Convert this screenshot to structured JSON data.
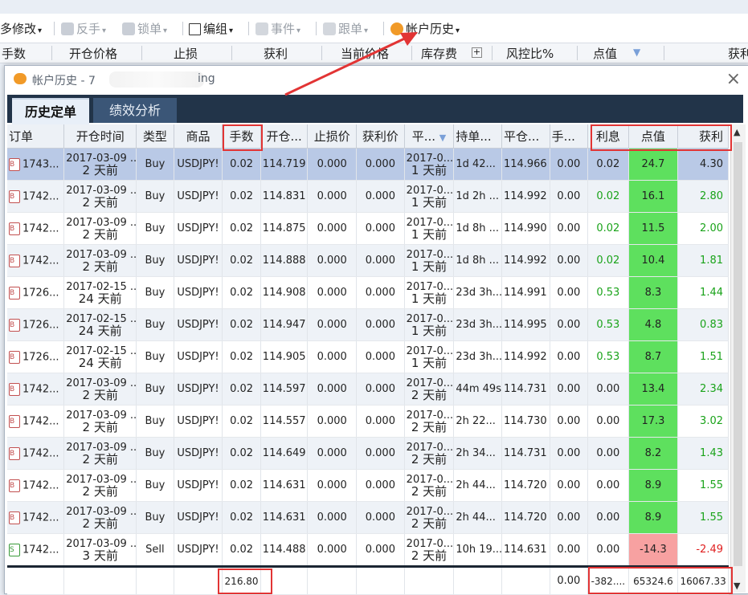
{
  "toolbar": {
    "items": [
      {
        "label": "多修改",
        "disabled": false
      },
      {
        "label": "反手",
        "disabled": true
      },
      {
        "label": "锁单",
        "disabled": true
      },
      {
        "label": "编组",
        "disabled": false
      },
      {
        "label": "事件",
        "disabled": true
      },
      {
        "label": "跟单",
        "disabled": true
      },
      {
        "label": "帐户历史",
        "disabled": false
      }
    ]
  },
  "bg_header": [
    "手数",
    "开仓价格",
    "止损",
    "获利",
    "当前价格",
    "库存费",
    "风控比%",
    "点值",
    "获利"
  ],
  "dialog": {
    "title": "帐户历史 - 7",
    "title_tail": "ing",
    "close": "×",
    "tabs": [
      "历史定单",
      "绩效分析"
    ]
  },
  "columns": [
    "订单",
    "开仓时间",
    "类型",
    "商品",
    "手数",
    "开仓...",
    "止损价",
    "获利价",
    "平...",
    "持单...",
    "平仓...",
    "手...",
    "利息",
    "点值",
    "获利"
  ],
  "rows": [
    {
      "order": "1743...",
      "type_icon": "B",
      "open_time": "2017-03-09 ...",
      "open_ago": "2 天前",
      "type": "Buy",
      "symbol": "USDJPY!",
      "lots": "0.02",
      "open_price": "114.719",
      "sl": "0.000",
      "tp": "0.000",
      "close_time": "2017-0...",
      "close_ago": "1 天前",
      "hold": "1d 42...",
      "close_price": "114.966",
      "fee": "0.00",
      "swap": "0.02",
      "points": "24.7",
      "profit": "4.30"
    },
    {
      "order": "1742...",
      "type_icon": "B",
      "open_time": "2017-03-09 ...",
      "open_ago": "2 天前",
      "type": "Buy",
      "symbol": "USDJPY!",
      "lots": "0.02",
      "open_price": "114.831",
      "sl": "0.000",
      "tp": "0.000",
      "close_time": "2017-0...",
      "close_ago": "1 天前",
      "hold": "1d 2h ...",
      "close_price": "114.992",
      "fee": "0.00",
      "swap": "0.02",
      "points": "16.1",
      "profit": "2.80"
    },
    {
      "order": "1742...",
      "type_icon": "B",
      "open_time": "2017-03-09 ...",
      "open_ago": "2 天前",
      "type": "Buy",
      "symbol": "USDJPY!",
      "lots": "0.02",
      "open_price": "114.875",
      "sl": "0.000",
      "tp": "0.000",
      "close_time": "2017-0...",
      "close_ago": "1 天前",
      "hold": "1d 8h ...",
      "close_price": "114.990",
      "fee": "0.00",
      "swap": "0.02",
      "points": "11.5",
      "profit": "2.00"
    },
    {
      "order": "1742...",
      "type_icon": "B",
      "open_time": "2017-03-09 ...",
      "open_ago": "2 天前",
      "type": "Buy",
      "symbol": "USDJPY!",
      "lots": "0.02",
      "open_price": "114.888",
      "sl": "0.000",
      "tp": "0.000",
      "close_time": "2017-0...",
      "close_ago": "1 天前",
      "hold": "1d 8h ...",
      "close_price": "114.992",
      "fee": "0.00",
      "swap": "0.02",
      "points": "10.4",
      "profit": "1.81"
    },
    {
      "order": "1726...",
      "type_icon": "B",
      "open_time": "2017-02-15 ...",
      "open_ago": "24 天前",
      "type": "Buy",
      "symbol": "USDJPY!",
      "lots": "0.02",
      "open_price": "114.908",
      "sl": "0.000",
      "tp": "0.000",
      "close_time": "2017-0...",
      "close_ago": "1 天前",
      "hold": "23d 3h...",
      "close_price": "114.991",
      "fee": "0.00",
      "swap": "0.53",
      "points": "8.3",
      "profit": "1.44"
    },
    {
      "order": "1726...",
      "type_icon": "B",
      "open_time": "2017-02-15 ...",
      "open_ago": "24 天前",
      "type": "Buy",
      "symbol": "USDJPY!",
      "lots": "0.02",
      "open_price": "114.947",
      "sl": "0.000",
      "tp": "0.000",
      "close_time": "2017-0...",
      "close_ago": "1 天前",
      "hold": "23d 3h...",
      "close_price": "114.995",
      "fee": "0.00",
      "swap": "0.53",
      "points": "4.8",
      "profit": "0.83"
    },
    {
      "order": "1726...",
      "type_icon": "B",
      "open_time": "2017-02-15 ...",
      "open_ago": "24 天前",
      "type": "Buy",
      "symbol": "USDJPY!",
      "lots": "0.02",
      "open_price": "114.905",
      "sl": "0.000",
      "tp": "0.000",
      "close_time": "2017-0...",
      "close_ago": "1 天前",
      "hold": "23d 3h...",
      "close_price": "114.992",
      "fee": "0.00",
      "swap": "0.53",
      "points": "8.7",
      "profit": "1.51"
    },
    {
      "order": "1742...",
      "type_icon": "B",
      "open_time": "2017-03-09 ...",
      "open_ago": "2 天前",
      "type": "Buy",
      "symbol": "USDJPY!",
      "lots": "0.02",
      "open_price": "114.597",
      "sl": "0.000",
      "tp": "0.000",
      "close_time": "2017-0...",
      "close_ago": "2 天前",
      "hold": "44m 49s",
      "close_price": "114.731",
      "fee": "0.00",
      "swap": "0.00",
      "points": "13.4",
      "profit": "2.34"
    },
    {
      "order": "1742...",
      "type_icon": "B",
      "open_time": "2017-03-09 ...",
      "open_ago": "2 天前",
      "type": "Buy",
      "symbol": "USDJPY!",
      "lots": "0.02",
      "open_price": "114.557",
      "sl": "0.000",
      "tp": "0.000",
      "close_time": "2017-0...",
      "close_ago": "2 天前",
      "hold": "2h 22...",
      "close_price": "114.730",
      "fee": "0.00",
      "swap": "0.00",
      "points": "17.3",
      "profit": "3.02"
    },
    {
      "order": "1742...",
      "type_icon": "B",
      "open_time": "2017-03-09 ...",
      "open_ago": "2 天前",
      "type": "Buy",
      "symbol": "USDJPY!",
      "lots": "0.02",
      "open_price": "114.649",
      "sl": "0.000",
      "tp": "0.000",
      "close_time": "2017-0...",
      "close_ago": "2 天前",
      "hold": "2h 34...",
      "close_price": "114.731",
      "fee": "0.00",
      "swap": "0.00",
      "points": "8.2",
      "profit": "1.43"
    },
    {
      "order": "1742...",
      "type_icon": "B",
      "open_time": "2017-03-09 ...",
      "open_ago": "2 天前",
      "type": "Buy",
      "symbol": "USDJPY!",
      "lots": "0.02",
      "open_price": "114.631",
      "sl": "0.000",
      "tp": "0.000",
      "close_time": "2017-0...",
      "close_ago": "2 天前",
      "hold": "2h 44...",
      "close_price": "114.720",
      "fee": "0.00",
      "swap": "0.00",
      "points": "8.9",
      "profit": "1.55"
    },
    {
      "order": "1742...",
      "type_icon": "B",
      "open_time": "2017-03-09 ...",
      "open_ago": "2 天前",
      "type": "Buy",
      "symbol": "USDJPY!",
      "lots": "0.02",
      "open_price": "114.631",
      "sl": "0.000",
      "tp": "0.000",
      "close_time": "2017-0...",
      "close_ago": "2 天前",
      "hold": "2h 44...",
      "close_price": "114.720",
      "fee": "0.00",
      "swap": "0.00",
      "points": "8.9",
      "profit": "1.55"
    },
    {
      "order": "1742...",
      "type_icon": "S",
      "open_time": "2017-03-09 ...",
      "open_ago": "3 天前",
      "type": "Sell",
      "symbol": "USDJPY!",
      "lots": "0.02",
      "open_price": "114.488",
      "sl": "0.000",
      "tp": "0.000",
      "close_time": "2017-0...",
      "close_ago": "2 天前",
      "hold": "10h 19...",
      "close_price": "114.631",
      "fee": "0.00",
      "swap": "0.00",
      "points": "-14.3",
      "profit": "-2.49"
    }
  ],
  "totals": {
    "lots": "216.80",
    "fee": "0.00",
    "swap": "-382....",
    "points": "65324.6",
    "profit": "16067.33"
  },
  "colors": {
    "tab_bar": "#223449",
    "selected_row": "#b9c9e6",
    "points_positive": "#5ee05e",
    "points_negative": "#f7a1a1",
    "profit_positive": "#1aa31a",
    "profit_negative": "#e02020",
    "annotation": "#e23434"
  }
}
